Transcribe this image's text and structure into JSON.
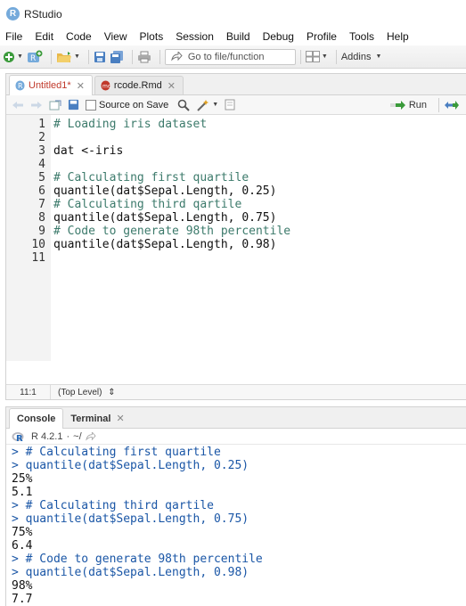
{
  "app": {
    "title": "RStudio",
    "logo_letter": "R"
  },
  "menu": [
    "File",
    "Edit",
    "Code",
    "View",
    "Plots",
    "Session",
    "Build",
    "Debug",
    "Profile",
    "Tools",
    "Help"
  ],
  "toolbar": {
    "goto_placeholder": "Go to file/function",
    "addins_label": "Addins"
  },
  "editor": {
    "tabs": [
      {
        "label": "Untitled1*",
        "modified": true,
        "active": true,
        "icon": "r-script-icon"
      },
      {
        "label": "rcode.Rmd",
        "modified": false,
        "active": false,
        "icon": "rmd-file-icon"
      }
    ],
    "source_on_save_label": "Source on Save",
    "run_label": "Run",
    "line_numbers": [
      "1",
      "2",
      "3",
      "4",
      "5",
      "6",
      "7",
      "8",
      "9",
      "10",
      "11"
    ],
    "lines": [
      "# Loading iris dataset",
      "",
      "dat <-iris",
      "",
      "# Calculating first quartile",
      "quantile(dat$Sepal.Length, 0.25)",
      "# Calculating third qartile",
      "quantile(dat$Sepal.Length, 0.75)",
      "# Code to generate 98th percentile",
      "quantile(dat$Sepal.Length, 0.98)",
      ""
    ],
    "cursor_position": "11:1",
    "scope": "(Top Level)"
  },
  "console": {
    "tabs": [
      {
        "label": "Console",
        "active": true
      },
      {
        "label": "Terminal",
        "active": false
      }
    ],
    "r_version": "R 4.2.1",
    "working_dir": "~/",
    "output": [
      "> # Calculating first quartile",
      "> quantile(dat$Sepal.Length, 0.25)",
      "25%",
      "5.1",
      "> # Calculating third qartile",
      "> quantile(dat$Sepal.Length, 0.75)",
      "75%",
      "6.4",
      "> # Code to generate 98th percentile",
      "> quantile(dat$Sepal.Length, 0.98)",
      "98%",
      "7.7"
    ]
  },
  "colors": {
    "accent": "#75aadb",
    "comment": "#3c7a6b",
    "prompt": "#1a56a6",
    "modified_tab": "#c0392b"
  }
}
